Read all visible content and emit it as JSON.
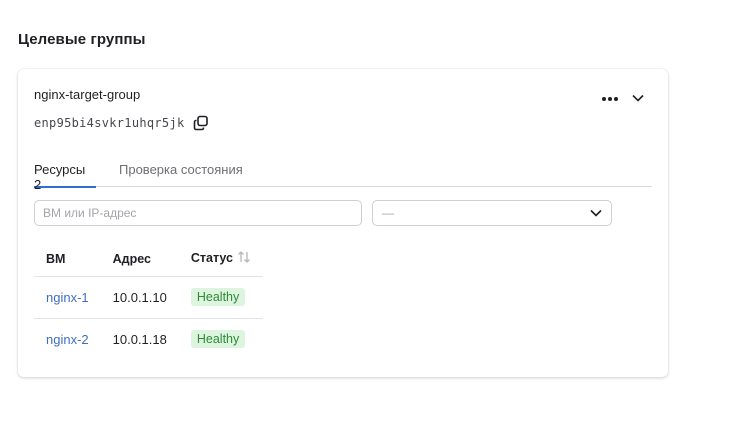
{
  "page": {
    "title": "Целевые группы"
  },
  "group": {
    "name": "nginx-target-group",
    "id": "enp95bi4svkr1uhqr5jk"
  },
  "tabs": [
    {
      "label": "Ресурсы 2",
      "active": true
    },
    {
      "label": "Проверка состояния",
      "active": false
    }
  ],
  "filters": {
    "search_placeholder": "ВМ или IP-адрес",
    "status_value": "—"
  },
  "table": {
    "headers": {
      "vm": "ВМ",
      "address": "Адрес",
      "status": "Статус"
    },
    "rows": [
      {
        "vm": "nginx-1",
        "address": "10.0.1.10",
        "status": "Healthy"
      },
      {
        "vm": "nginx-2",
        "address": "10.0.1.18",
        "status": "Healthy"
      }
    ]
  },
  "icons": {
    "copy": "copy-icon",
    "more": "ellipsis-icon",
    "chevron": "chevron-down-icon",
    "sort": "sort-icon"
  },
  "colors": {
    "accent": "#2f6fd4",
    "link": "#3e6fc5",
    "badge_bg": "#ddf5de",
    "badge_text": "#2f8a3a"
  }
}
